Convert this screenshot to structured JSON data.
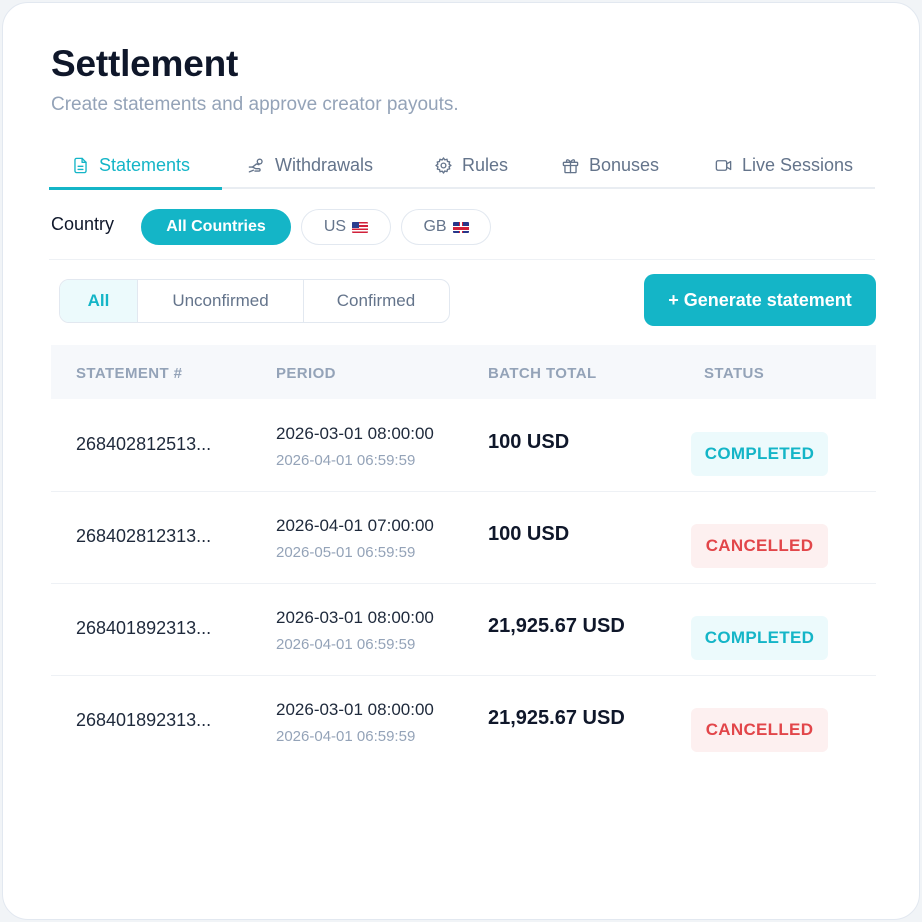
{
  "header": {
    "title": "Settlement",
    "subtitle": "Create statements and approve creator payouts."
  },
  "tabs": [
    {
      "label": "Statements",
      "icon": "document-icon",
      "active": true
    },
    {
      "label": "Withdrawals",
      "icon": "hand-coins-icon",
      "active": false
    },
    {
      "label": "Rules",
      "icon": "gear-icon",
      "active": false
    },
    {
      "label": "Bonuses",
      "icon": "gift-icon",
      "active": false
    },
    {
      "label": "Live Sessions",
      "icon": "video-icon",
      "active": false
    }
  ],
  "country_filter": {
    "label": "Country",
    "options": [
      {
        "label": "All Countries",
        "flag": "",
        "active": true
      },
      {
        "label": "US",
        "flag": "us-flag-icon",
        "active": false
      },
      {
        "label": "GB",
        "flag": "gb-flag-icon",
        "active": false
      }
    ]
  },
  "status_filter": {
    "options": [
      {
        "label": "All",
        "active": true
      },
      {
        "label": "Unconfirmed",
        "active": false
      },
      {
        "label": "Confirmed",
        "active": false
      }
    ]
  },
  "generate_button": {
    "label": "+ Generate statement"
  },
  "table": {
    "columns": [
      "STATEMENT #",
      "PERIOD",
      "BATCH TOTAL",
      "STATUS"
    ],
    "rows": [
      {
        "id": "268402812513...",
        "period_start": "2026-03-01 08:00:00",
        "period_end": "2026-04-01 06:59:59",
        "total": "100 USD",
        "status": "COMPLETED",
        "status_type": "completed"
      },
      {
        "id": "268402812313...",
        "period_start": "2026-04-01 07:00:00",
        "period_end": "2026-05-01 06:59:59",
        "total": "100 USD",
        "status": "CANCELLED",
        "status_type": "cancelled"
      },
      {
        "id": "268401892313...",
        "period_start": "2026-03-01 08:00:00",
        "period_end": "2026-04-01 06:59:59",
        "total": "21,925.67 USD",
        "status": "COMPLETED",
        "status_type": "completed"
      },
      {
        "id": "268401892313...",
        "period_start": "2026-03-01 08:00:00",
        "period_end": "2026-04-01 06:59:59",
        "total": "21,925.67 USD",
        "status": "CANCELLED",
        "status_type": "cancelled"
      }
    ]
  },
  "colors": {
    "accent": "#14b5c7",
    "danger": "#e2464a",
    "muted": "#94a3b8"
  }
}
